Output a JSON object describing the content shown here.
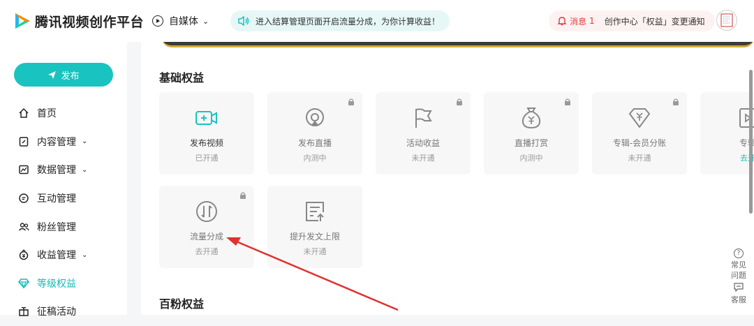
{
  "header": {
    "brand": "腾讯视频创作平台",
    "media_type": "自媒体",
    "notice": "进入结算管理页面开启流量分成，为你计算收益！",
    "message_label": "消息",
    "message_count": "1",
    "message_text": "创作中心「权益」变更通知"
  },
  "sidebar": {
    "publish_label": "发布",
    "items": [
      {
        "label": "首页",
        "icon": "home-icon"
      },
      {
        "label": "内容管理",
        "icon": "content-icon"
      },
      {
        "label": "数据管理",
        "icon": "chart-icon"
      },
      {
        "label": "互动管理",
        "icon": "chat-icon"
      },
      {
        "label": "粉丝管理",
        "icon": "fans-icon"
      },
      {
        "label": "收益管理",
        "icon": "income-icon"
      },
      {
        "label": "等级权益",
        "icon": "diamond-icon"
      },
      {
        "label": "征稿活动",
        "icon": "gift-icon"
      }
    ]
  },
  "main": {
    "section1_title": "基础权益",
    "section2_title": "百粉权益",
    "cards": [
      {
        "name": "发布视频",
        "state": "已开通",
        "icon": "video-add-icon",
        "locked": false
      },
      {
        "name": "发布直播",
        "state": "内测中",
        "icon": "live-icon",
        "locked": true
      },
      {
        "name": "活动收益",
        "state": "未开通",
        "icon": "flag-icon",
        "locked": true
      },
      {
        "name": "直播打赏",
        "state": "内测中",
        "icon": "money-bag-icon",
        "locked": true
      },
      {
        "name": "专辑-会员分账",
        "state": "未开通",
        "icon": "diamond-yen-icon",
        "locked": true
      },
      {
        "name": "专辑",
        "state": "去开",
        "icon": "album-icon",
        "locked": false
      },
      {
        "name": "流量分成",
        "state": "去开通",
        "icon": "traffic-share-icon",
        "locked": true
      },
      {
        "name": "提升发文上限",
        "state": "未开通",
        "icon": "upload-doc-icon",
        "locked": false
      }
    ]
  },
  "float": {
    "faq": "常见问题",
    "service": "客服"
  },
  "colors": {
    "accent": "#19c3c0",
    "alert": "#e4393c",
    "annotation_arrow": "#e0322e"
  }
}
